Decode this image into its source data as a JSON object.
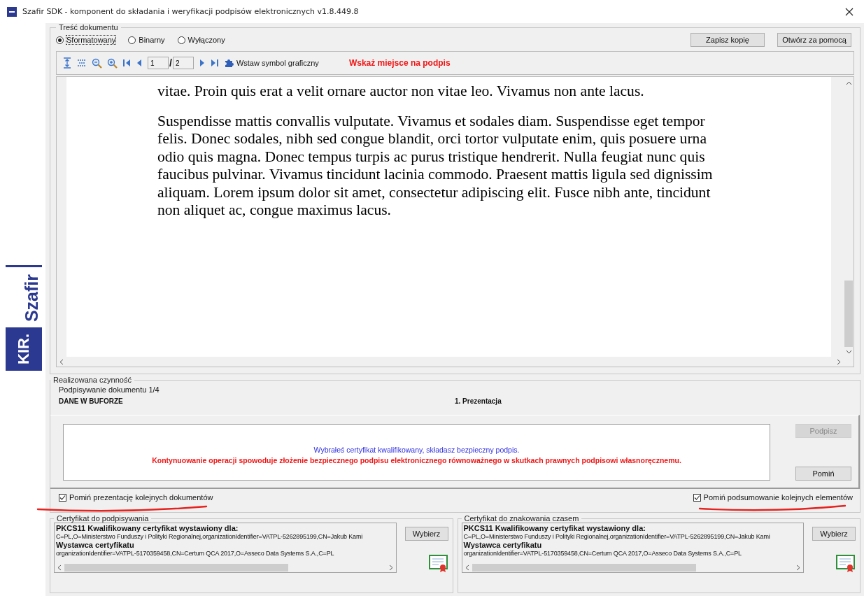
{
  "window": {
    "title": "Szafir SDK - komponent do składania i weryfikacji podpisów elektronicznych v1.8.449.8"
  },
  "logo": {
    "brand": "Szafir",
    "company": "KIR."
  },
  "document_group": {
    "title": "Treść dokumentu",
    "modes": [
      {
        "label": "Sformatowany",
        "selected": true
      },
      {
        "label": "Binarny",
        "selected": false
      },
      {
        "label": "Wyłączony",
        "selected": false
      }
    ],
    "buttons": [
      "Zapisz kopię",
      "Otwórz za pomocą"
    ],
    "toolbar": {
      "page": "1",
      "separator": "/",
      "page_count": "2",
      "insert_label": "Wstaw symbol graficzny",
      "hint": "Wskaż miejsce na podpis"
    },
    "paragraphs": [
      "vitae. Proin quis erat a velit ornare auctor non vitae leo. Vivamus non ante lacus.",
      "Suspendisse mattis convallis vulputate. Vivamus et sodales diam. Suspendisse eget tempor felis. Donec sodales, nibh sed congue blandit, orci tortor vulputate enim, quis posuere urna odio quis magna. Donec tempus turpis ac purus tristique hendrerit. Nulla feugiat nunc quis faucibus pulvinar. Vivamus tincidunt lacinia commodo. Praesent mattis ligula sed dignissim aliquam. Lorem ipsum dolor sit amet, consectetur adipiscing elit. Fusce nibh ante, tincidunt non aliquet ac, congue maximus lacus."
    ]
  },
  "action_group": {
    "title": "Realizowana czynność",
    "step": "Podpisywanie dokumentu 1/4",
    "source": "DANE W BUFORZE",
    "stage": "1. Prezentacja",
    "info": "Wybrałeś certyfikat kwalifikowany, składasz bezpieczny podpis.",
    "warning": "Kontynuowanie operacji spowoduje złożenie bezpiecznego podpisu elektronicznego równoważnego w skutkach prawnych podpisowi własnoręcznemu.",
    "buttons": [
      {
        "label": "Podpisz",
        "disabled": true
      },
      {
        "label": "Pomiń",
        "disabled": false
      }
    ],
    "options": [
      {
        "label": "Pomiń prezentację kolejnych dokumentów",
        "checked": true
      },
      {
        "label": "Pomiń podsumowanie kolejnych elementów",
        "checked": true
      }
    ]
  },
  "certificates": [
    {
      "title": "Certyfikat do podpisywania",
      "heading": "PKCS11 Kwalifikowany certyfikat wystawiony dla:",
      "subject": "C=PL,O=Ministerstwo Funduszy i Polityki Regionalnej,organizationIdentifier=VATPL-5262895199,CN=Jakub Kami",
      "issuer_heading": "Wystawca certyfikatu",
      "issuer": "organizationIdentifier=VATPL-5170359458,CN=Certum QCA 2017,O=Asseco Data Systems S.A.,C=PL",
      "button": "Wybierz"
    },
    {
      "title": "Certyfikat do znakowania czasem",
      "heading": "PKCS11 Kwalifikowany certyfikat wystawiony dla:",
      "subject": "C=PL,O=Ministerstwo Funduszy i Polityki Regionalnej,organizationIdentifier=VATPL-5262895199,CN=Jakub Kami",
      "issuer_heading": "Wystawca certyfikatu",
      "issuer": "organizationIdentifier=VATPL-5170359458,CN=Certum QCA 2017,O=Asseco Data Systems S.A.,C=PL",
      "button": "Wybierz"
    }
  ]
}
